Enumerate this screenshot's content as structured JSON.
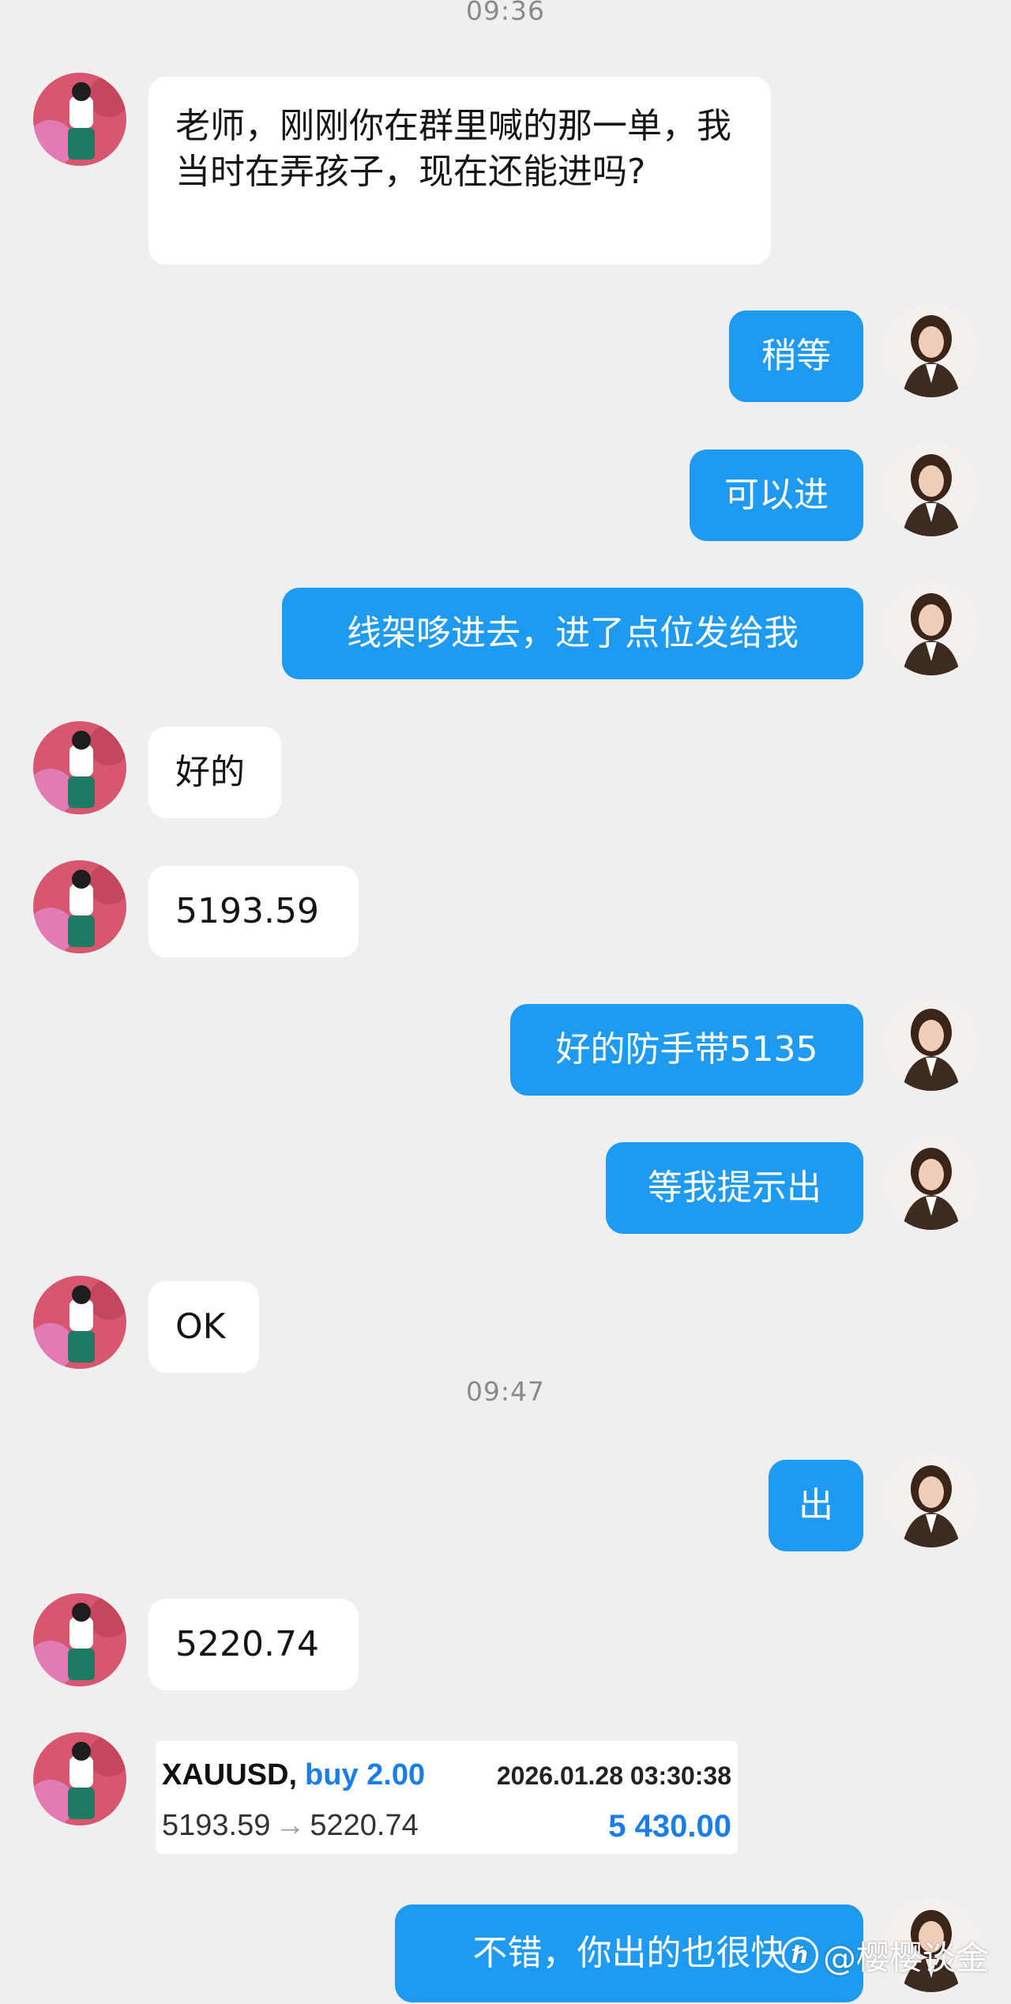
{
  "timestamps": [
    "09:36",
    "09:47"
  ],
  "messages": [
    {
      "side": "left",
      "text": "老师，刚刚你在群里喊的那一单，我当时在弄孩子，现在还能进吗?"
    },
    {
      "side": "right",
      "text": "稍等"
    },
    {
      "side": "right",
      "text": "可以进"
    },
    {
      "side": "right",
      "text": "线架哆进去，进了点位发给我"
    },
    {
      "side": "left",
      "text": "好的"
    },
    {
      "side": "left",
      "text": "5193.59"
    },
    {
      "side": "right",
      "text": "好的防手带5135"
    },
    {
      "side": "right",
      "text": "等我提示出"
    },
    {
      "side": "left",
      "text": "OK"
    },
    {
      "side": "right",
      "text": "出"
    },
    {
      "side": "left",
      "text": "5220.74"
    },
    {
      "side": "right",
      "text": "不错，你出的也很快"
    }
  ],
  "trade_card": {
    "symbol": "XAUUSD,",
    "side": "buy 2.00",
    "datetime": "2026.01.28 03:30:38",
    "open_price": "5193.59",
    "arrow": "→",
    "close_price": "5220.74",
    "profit": "5 430.00"
  },
  "watermark": {
    "logo_char": "ℏ",
    "text": "@樱樱谈金"
  },
  "colors": {
    "background": "#efefef",
    "right_bubble": "#1e9bf0",
    "left_bubble": "#ffffff",
    "profit_blue": "#1a7ee8"
  }
}
